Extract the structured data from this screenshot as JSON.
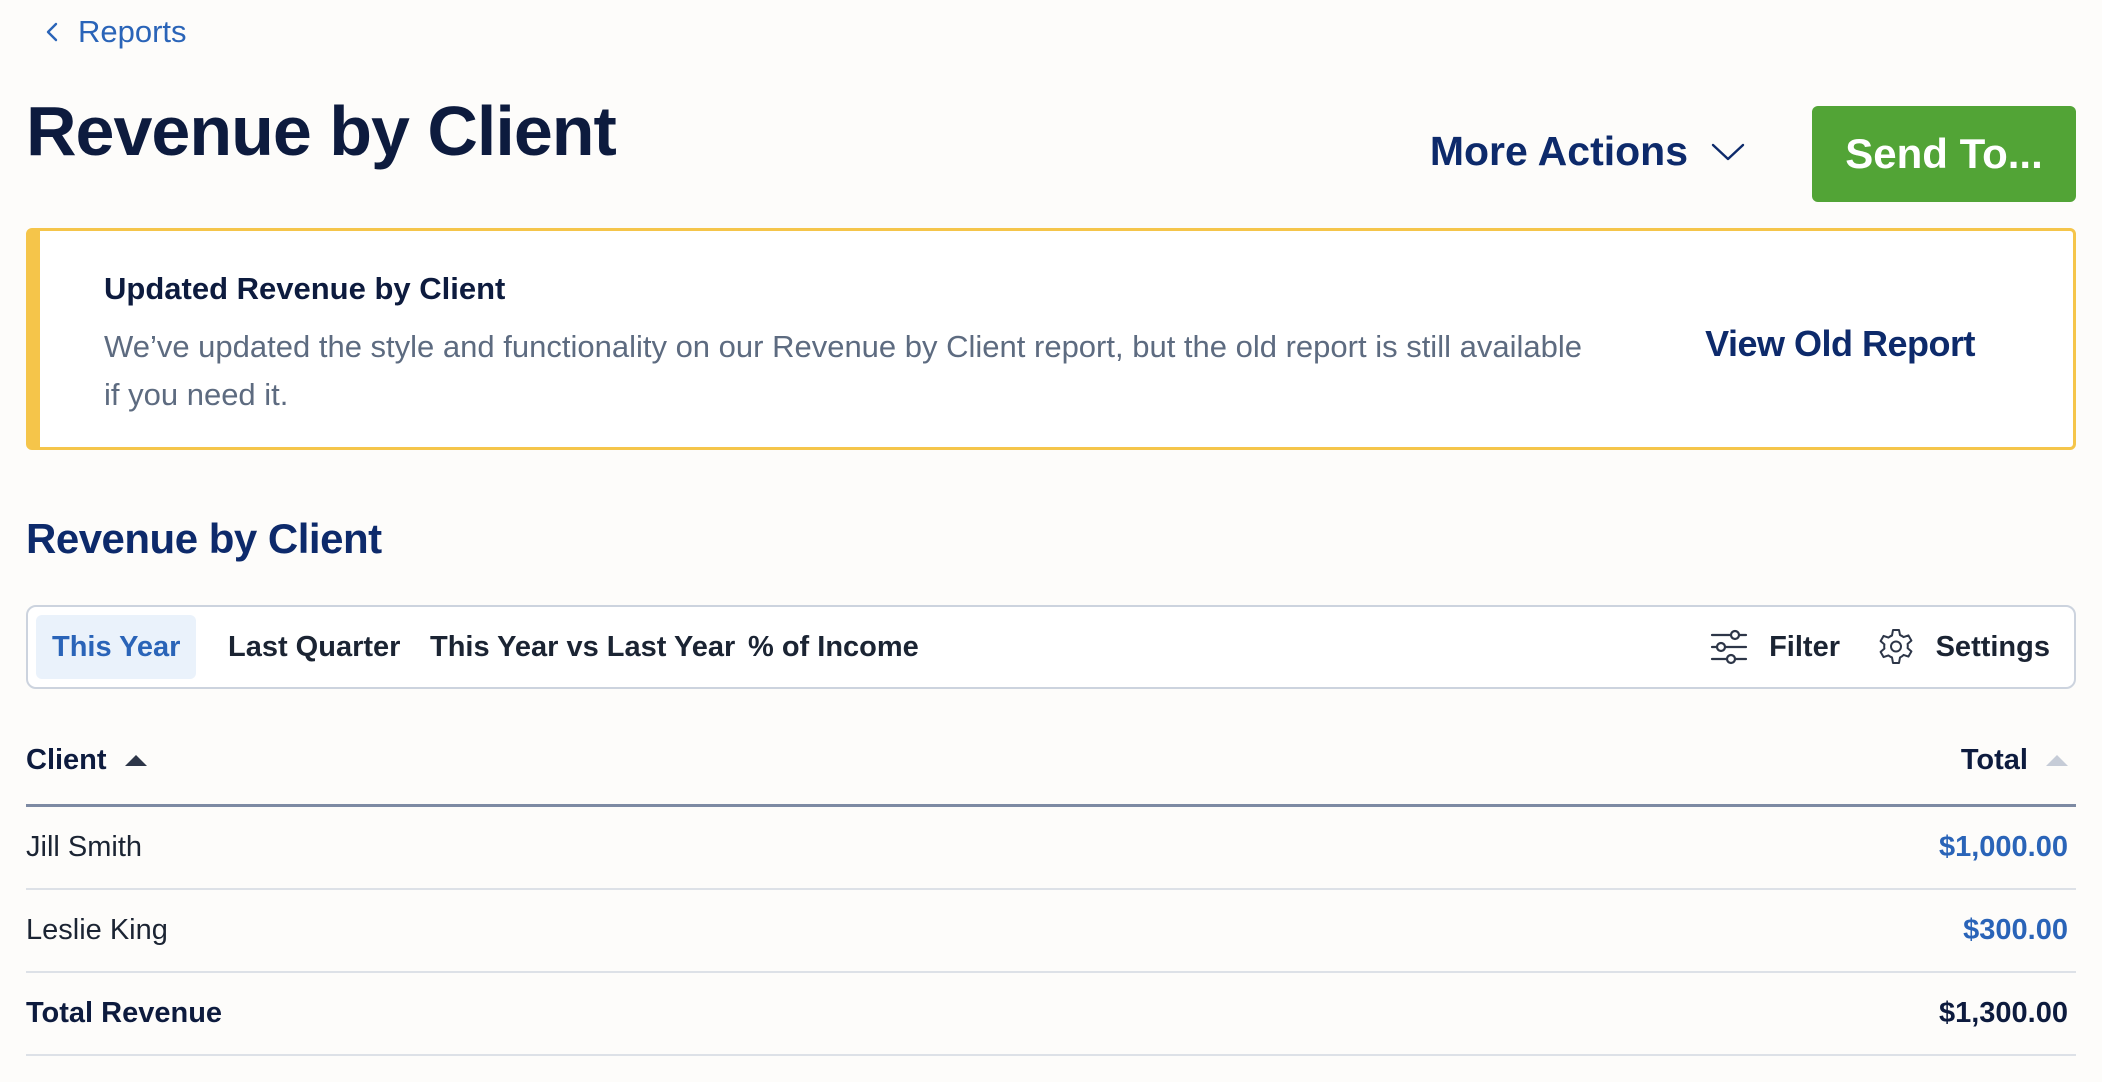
{
  "breadcrumb": {
    "label": "Reports"
  },
  "header": {
    "title": "Revenue by Client",
    "more_actions_label": "More Actions",
    "send_label": "Send To..."
  },
  "banner": {
    "title": "Updated Revenue by Client",
    "body": "We’ve updated the style and functionality on our Revenue by Client report, but the old report is still available if you need it.",
    "link_label": "View Old Report"
  },
  "section": {
    "title": "Revenue by Client"
  },
  "tabs": [
    {
      "label": "This Year",
      "active": true
    },
    {
      "label": "Last Quarter",
      "active": false
    },
    {
      "label": "This Year vs Last Year",
      "active": false
    },
    {
      "label": "% of Income",
      "active": false
    }
  ],
  "tools": {
    "filter_label": "Filter",
    "settings_label": "Settings"
  },
  "table": {
    "columns": {
      "client": "Client",
      "total": "Total"
    },
    "rows": [
      {
        "client": "Jill Smith",
        "total": "$1,000.00"
      },
      {
        "client": "Leslie King",
        "total": "$300.00"
      }
    ],
    "footer": {
      "client": "Total Revenue",
      "total": "$1,300.00"
    }
  },
  "colors": {
    "primary_navy": "#0d2a6b",
    "link_blue": "#2a64b8",
    "send_green": "#52a436",
    "banner_yellow": "#f5c54a",
    "active_tab_bg": "#eaf2fb"
  },
  "icons": {
    "breadcrumb": "chevron-left-icon",
    "more_actions": "chevron-down-icon",
    "filter": "sliders-icon",
    "settings": "gear-icon",
    "sort": "sort-ascending-icon"
  }
}
